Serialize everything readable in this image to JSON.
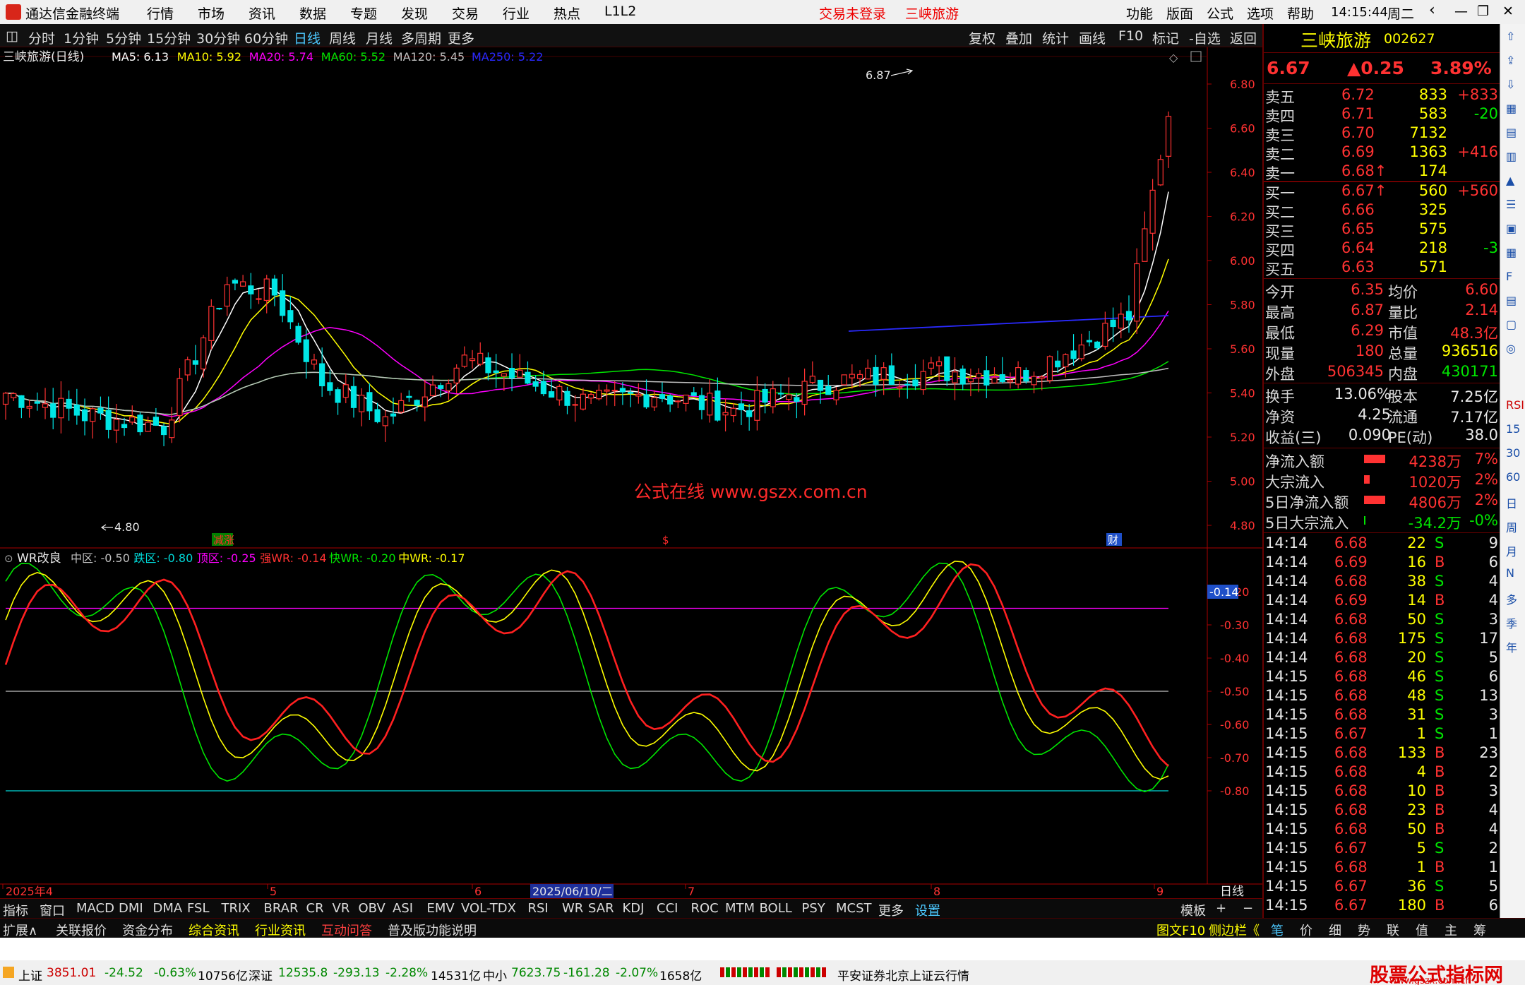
{
  "app": {
    "title": "通达信金融终端",
    "menu": [
      "行情",
      "市场",
      "资讯",
      "数据",
      "专题",
      "发现",
      "交易",
      "行业",
      "热点",
      "L1L2"
    ],
    "status_login": "交易未登录",
    "status_stock": "三峡旅游",
    "right_menu": [
      "功能",
      "版面",
      "公式",
      "选项",
      "帮助"
    ],
    "time": "14:15:44",
    "weekday": "周二"
  },
  "toolbar": {
    "periods": [
      "分时",
      "1分钟",
      "5分钟",
      "15分钟",
      "30分钟",
      "60分钟",
      "日线",
      "周线",
      "月线",
      "多周期",
      "更多"
    ],
    "active_period": "日线",
    "tools": [
      "复权",
      "叠加",
      "统计",
      "画线",
      "F10",
      "标记",
      "-自选",
      "返回"
    ]
  },
  "main_chart": {
    "title": "三峡旅游(日线)",
    "ma": [
      {
        "label": "MA5: 6.13",
        "color": "#ffffff"
      },
      {
        "label": "MA10: 5.92",
        "color": "#ffff00"
      },
      {
        "label": "MA20: 5.74",
        "color": "#ff00ff"
      },
      {
        "label": "MA60: 5.52",
        "color": "#00e600"
      },
      {
        "label": "MA120: 5.45",
        "color": "#c0c0c0"
      },
      {
        "label": "MA250: 5.22",
        "color": "#2a2aff"
      }
    ],
    "y_ticks": [
      "6.80",
      "6.60",
      "6.40",
      "6.20",
      "6.00",
      "5.80",
      "5.60",
      "5.40",
      "5.20",
      "5.00",
      "4.80"
    ],
    "high_mark": "6.87",
    "low_mark": "4.80",
    "watermark": "公式在线 www.gszx.com.cn",
    "markers": [
      "减涨",
      "$",
      "财"
    ]
  },
  "indicator": {
    "title": "WR改良",
    "params": [
      {
        "label": "中区: -0.50",
        "color": "#c0c0c0"
      },
      {
        "label": "跌区: -0.80",
        "color": "#00d8d8"
      },
      {
        "label": "顶区: -0.25",
        "color": "#ff00ff"
      },
      {
        "label": "强WR: -0.14",
        "color": "#ff3232"
      },
      {
        "label": "快WR: -0.20",
        "color": "#00e600"
      },
      {
        "label": "中WR: -0.17",
        "color": "#ffff00"
      }
    ],
    "y_ticks": [
      "-0.20",
      "-0.30",
      "-0.40",
      "-0.50",
      "-0.60",
      "-0.70",
      "-0.80"
    ],
    "current_value": "-0.14"
  },
  "x_axis": {
    "labels": [
      "2025年4",
      "5",
      "6",
      "7",
      "8",
      "9"
    ],
    "cursor_date": "2025/06/10/二",
    "period_label": "日线"
  },
  "indicator_tabs": [
    "指标",
    "窗口",
    "MACD",
    "DMI",
    "DMA",
    "FSL",
    "TRIX",
    "BRAR",
    "CR",
    "VR",
    "OBV",
    "ASI",
    "EMV",
    "VOL-TDX",
    "RSI",
    "WR",
    "SAR",
    "KDJ",
    "CCI",
    "ROC",
    "MTM",
    "BOLL",
    "PSY",
    "MCST",
    "更多",
    "设置"
  ],
  "template_label": "模板",
  "ext_tabs": [
    "扩展∧",
    "关联报价",
    "资金分布",
    "综合资讯",
    "行业资讯",
    "互动问答",
    "普及版功能说明"
  ],
  "ext_right": [
    "图文F10",
    "侧边栏《"
  ],
  "bottom_tabs": [
    "笔",
    "价",
    "细",
    "势",
    "联",
    "值",
    "主",
    "筹"
  ],
  "quote": {
    "name": "三峡旅游",
    "code": "002627",
    "price": "6.67",
    "change": "▲0.25",
    "pct": "3.89%",
    "asks": [
      {
        "label": "卖五",
        "price": "6.72",
        "vol": "833",
        "chg": "+833"
      },
      {
        "label": "卖四",
        "price": "6.71",
        "vol": "583",
        "chg": "-20"
      },
      {
        "label": "卖三",
        "price": "6.70",
        "vol": "7132",
        "chg": ""
      },
      {
        "label": "卖二",
        "price": "6.69",
        "vol": "1363",
        "chg": "+416"
      },
      {
        "label": "卖一",
        "price": "6.68↑",
        "vol": "174",
        "chg": ""
      }
    ],
    "bids": [
      {
        "label": "买一",
        "price": "6.67↑",
        "vol": "560",
        "chg": "+560"
      },
      {
        "label": "买二",
        "price": "6.66",
        "vol": "325",
        "chg": ""
      },
      {
        "label": "买三",
        "price": "6.65",
        "vol": "575",
        "chg": ""
      },
      {
        "label": "买四",
        "price": "6.64",
        "vol": "218",
        "chg": "-3"
      },
      {
        "label": "买五",
        "price": "6.63",
        "vol": "571",
        "chg": ""
      }
    ],
    "stats": [
      {
        "k1": "今开",
        "v1": "6.35",
        "k2": "均价",
        "v2": "6.60"
      },
      {
        "k1": "最高",
        "v1": "6.87",
        "k2": "量比",
        "v2": "2.14"
      },
      {
        "k1": "最低",
        "v1": "6.29",
        "k2": "市值",
        "v2": "48.3亿"
      },
      {
        "k1": "现量",
        "v1": "180",
        "k2": "总量",
        "v2": "936516"
      },
      {
        "k1": "外盘",
        "v1": "506345",
        "k2": "内盘",
        "v2": "430171"
      }
    ],
    "fin": [
      {
        "k1": "换手",
        "v1": "13.06%",
        "k2": "股本",
        "v2": "7.25亿"
      },
      {
        "k1": "净资",
        "v1": "4.25",
        "k2": "流通",
        "v2": "7.17亿"
      },
      {
        "k1": "收益(三)",
        "v1": "0.090",
        "k2": "PE(动)",
        "v2": "38.0"
      }
    ],
    "flows": [
      {
        "label": "净流入额",
        "value": "4238万",
        "pct": "7%"
      },
      {
        "label": "大宗流入",
        "value": "1020万",
        "pct": "2%"
      },
      {
        "label": "5日净流入额",
        "value": "4806万",
        "pct": "2%"
      },
      {
        "label": "5日大宗流入",
        "value": "-34.2万",
        "pct": "-0%"
      }
    ],
    "ticks": [
      [
        "14:14",
        "6.68",
        "22",
        "S",
        "9"
      ],
      [
        "14:14",
        "6.69",
        "16",
        "B",
        "6"
      ],
      [
        "14:14",
        "6.68",
        "38",
        "S",
        "4"
      ],
      [
        "14:14",
        "6.69",
        "14",
        "B",
        "4"
      ],
      [
        "14:14",
        "6.68",
        "50",
        "S",
        "3"
      ],
      [
        "14:14",
        "6.68",
        "175",
        "S",
        "17"
      ],
      [
        "14:14",
        "6.68",
        "20",
        "S",
        "5"
      ],
      [
        "14:15",
        "6.68",
        "46",
        "S",
        "6"
      ],
      [
        "14:15",
        "6.68",
        "48",
        "S",
        "13"
      ],
      [
        "14:15",
        "6.68",
        "31",
        "S",
        "3"
      ],
      [
        "14:15",
        "6.67",
        "1",
        "S",
        "1"
      ],
      [
        "14:15",
        "6.68",
        "133",
        "B",
        "23"
      ],
      [
        "14:15",
        "6.68",
        "4",
        "B",
        "2"
      ],
      [
        "14:15",
        "6.68",
        "10",
        "B",
        "3"
      ],
      [
        "14:15",
        "6.68",
        "23",
        "B",
        "4"
      ],
      [
        "14:15",
        "6.68",
        "50",
        "B",
        "4"
      ],
      [
        "14:15",
        "6.67",
        "5",
        "S",
        "2"
      ],
      [
        "14:15",
        "6.68",
        "1",
        "B",
        "1"
      ],
      [
        "14:15",
        "6.67",
        "36",
        "S",
        "5"
      ],
      [
        "14:15",
        "6.67",
        "180",
        "B",
        "6"
      ]
    ]
  },
  "sidebar_labels": [
    "RSI",
    "15",
    "30",
    "60",
    "日",
    "周",
    "月",
    "N",
    "多",
    "季",
    "年"
  ],
  "status": {
    "sh": {
      "name": "上证",
      "value": "3851.01",
      "chg": "-24.52",
      "pct": "-0.63%",
      "amt": "10756亿"
    },
    "sz": {
      "name": "深证",
      "value": "12535.8",
      "chg": "-293.13",
      "pct": "-2.28%",
      "amt": "14531亿"
    },
    "zx": {
      "name": "中小",
      "value": "7623.75",
      "chg": "-161.28",
      "pct": "-2.07%",
      "amt": "1658亿"
    },
    "server": "平安证券北京上证云行情",
    "site_logo": "股票公式指标网",
    "site_url": "www.gszx.com.cn"
  }
}
